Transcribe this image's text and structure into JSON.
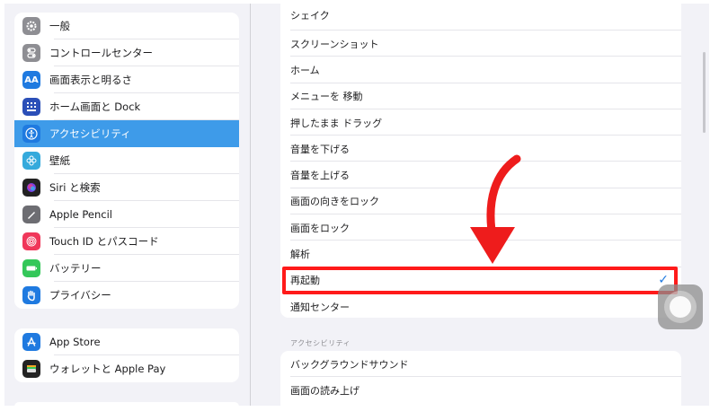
{
  "sidebar": {
    "items": [
      {
        "label": "一般",
        "icon": "gear-icon",
        "color": "#8e8e93"
      },
      {
        "label": "コントロールセンター",
        "icon": "toggles-icon",
        "color": "#8e8e93"
      },
      {
        "label": "画面表示と明るさ",
        "icon": "text-size-icon",
        "color": "#1f7ae0",
        "glyph": "AA"
      },
      {
        "label": "ホーム画面と Dock",
        "icon": "home-grid-icon",
        "color": "#2b4fb8"
      },
      {
        "label": "アクセシビリティ",
        "icon": "accessibility-icon",
        "color": "#1f7ae0",
        "selected": true
      },
      {
        "label": "壁紙",
        "icon": "wallpaper-icon",
        "color": "#35aadc"
      },
      {
        "label": "Siri と検索",
        "icon": "siri-icon",
        "color": "#222"
      },
      {
        "label": "Apple Pencil",
        "icon": "pencil-icon",
        "color": "#6d6d72"
      },
      {
        "label": "Touch ID とパスコード",
        "icon": "fingerprint-icon",
        "color": "#f0375a"
      },
      {
        "label": "バッテリー",
        "icon": "battery-icon",
        "color": "#34c759"
      },
      {
        "label": "プライバシー",
        "icon": "hand-icon",
        "color": "#1f7ae0"
      }
    ],
    "items2": [
      {
        "label": "App Store",
        "icon": "app-store-icon",
        "color": "#1f7ae0"
      },
      {
        "label": "ウォレットと Apple Pay",
        "icon": "wallet-icon",
        "color": "#222"
      }
    ]
  },
  "actions": {
    "items": [
      {
        "label": "シェイク"
      },
      {
        "label": "スクリーンショット"
      },
      {
        "label": "ホーム"
      },
      {
        "label": "メニューを 移動"
      },
      {
        "label": "押したまま ドラッグ"
      },
      {
        "label": "音量を下げる"
      },
      {
        "label": "音量を上げる"
      },
      {
        "label": "画面の向きをロック"
      },
      {
        "label": "画面をロック"
      },
      {
        "label": "解析"
      },
      {
        "label": "再起動",
        "checked": true
      },
      {
        "label": "通知センター"
      }
    ]
  },
  "accessibility_section": {
    "header": "アクセシビリティ",
    "items": [
      {
        "label": "バックグラウンドサウンド"
      },
      {
        "label": "画面の読み上げ"
      }
    ]
  },
  "check_mark": "✓",
  "colors": {
    "accent": "#1f7ae0",
    "selected_row": "#3e9be9",
    "highlight": "#ff1a1a"
  }
}
